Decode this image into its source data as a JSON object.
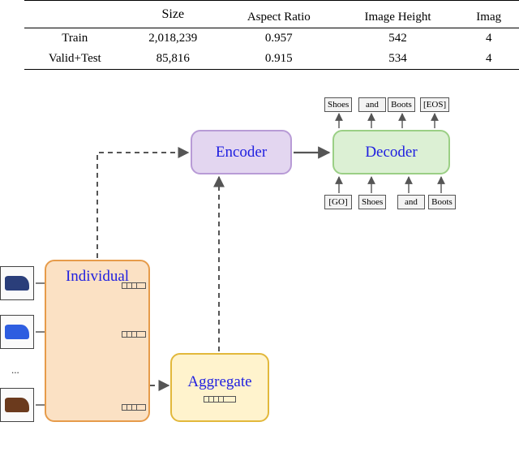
{
  "table": {
    "headers": {
      "size": "Size",
      "aspect": "Aspect Ratio",
      "height": "Image Height",
      "width_cut": "Imag"
    },
    "rows": [
      {
        "split": "Train",
        "size": "2,018,239",
        "aspect": "0.957",
        "height": "542",
        "width_cut": "4"
      },
      {
        "split": "Valid+Test",
        "size": "85,816",
        "aspect": "0.915",
        "height": "534",
        "width_cut": "4"
      }
    ]
  },
  "blocks": {
    "individual": "Individual",
    "aggregate": "Aggregate",
    "encoder": "Encoder",
    "decoder": "Decoder"
  },
  "decoder_io": {
    "outputs": [
      "Shoes",
      "and",
      "Boots",
      "[EOS]"
    ],
    "inputs": [
      "[GO]",
      "Shoes",
      "and",
      "Boots"
    ]
  },
  "misc": {
    "ellipsis": "..."
  }
}
